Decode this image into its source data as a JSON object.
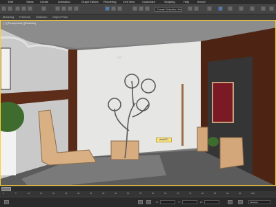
{
  "menu": {
    "items": [
      "Edit",
      "Tools",
      "Group",
      "Views",
      "Create",
      "Modifiers",
      "Animation",
      "Graph Editors",
      "Rendering",
      "Civil View",
      "Customize",
      "Scripting",
      "Help",
      "Arnold"
    ]
  },
  "toolbar": {
    "selection_set": "Create Selection Se"
  },
  "ribbon": {
    "items": [
      "Modeling",
      "Freeform",
      "Selection",
      "Object Paint",
      "Populate"
    ]
  },
  "viewport": {
    "label": "[+] [Perspective] [Realistic]",
    "tooltip": "chair001"
  },
  "trackbar": {
    "ticks": [
      "0",
      "5",
      "10",
      "15",
      "20",
      "25",
      "30",
      "35",
      "40",
      "45",
      "50",
      "55",
      "60",
      "65",
      "70",
      "75",
      "80",
      "85",
      "90",
      "95",
      "100"
    ]
  },
  "statusbar": {
    "x_label": "X:",
    "x_value": "",
    "y_label": "Y:",
    "y_value": "",
    "z_label": "Z:",
    "z_value": "",
    "key_mode": "Selected"
  }
}
